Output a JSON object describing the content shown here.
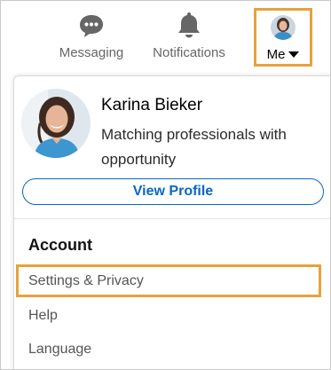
{
  "nav": {
    "messaging": {
      "label": "Messaging",
      "icon": "messaging-icon"
    },
    "notifications": {
      "label": "Notifications",
      "icon": "bell-icon"
    },
    "me": {
      "label": "Me",
      "icon": "caret-down-icon"
    }
  },
  "profile": {
    "name": "Karina Bieker",
    "headline": "Matching professionals with opportunity",
    "view_profile_label": "View Profile"
  },
  "account": {
    "heading": "Account",
    "items": [
      {
        "label": "Settings & Privacy",
        "highlighted": true
      },
      {
        "label": "Help",
        "highlighted": false
      },
      {
        "label": "Language",
        "highlighted": false
      }
    ]
  },
  "colors": {
    "highlight": "#e6a23c",
    "link_blue": "#0a66c2",
    "icon_gray": "#666666"
  }
}
